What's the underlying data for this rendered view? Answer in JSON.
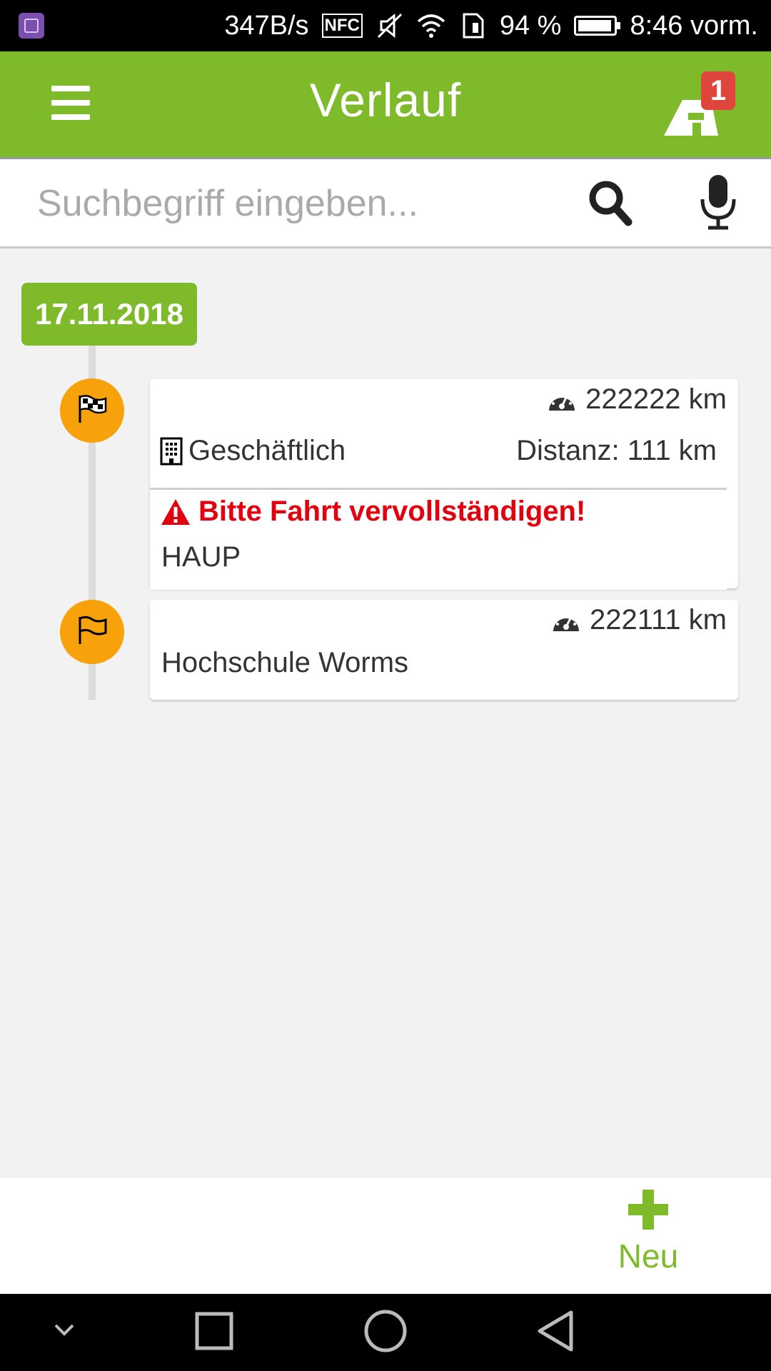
{
  "status_bar": {
    "speed": "347B/s",
    "nfc": "NFC",
    "battery": "94 %",
    "time": "8:46 vorm."
  },
  "app_bar": {
    "title": "Verlauf",
    "badge_count": "1"
  },
  "search": {
    "placeholder": "Suchbegriff eingeben..."
  },
  "timeline": {
    "date": "17.11.2018",
    "entries": [
      {
        "odometer": "222222 km",
        "trip_type": "Geschäftlich",
        "distance": "Distanz: 111 km",
        "warning": "Bitte Fahrt vervollständigen!",
        "location": "HAUP",
        "marker_icon": "checkered-flag-icon"
      },
      {
        "odometer": "222111 km",
        "location": "Hochschule Worms",
        "marker_icon": "flag-icon"
      }
    ]
  },
  "actions": {
    "new_label": "Neu"
  },
  "colors": {
    "primary": "#7fba2a",
    "marker": "#f7a20a",
    "warning": "#e3000f",
    "badge": "#e0453b"
  }
}
